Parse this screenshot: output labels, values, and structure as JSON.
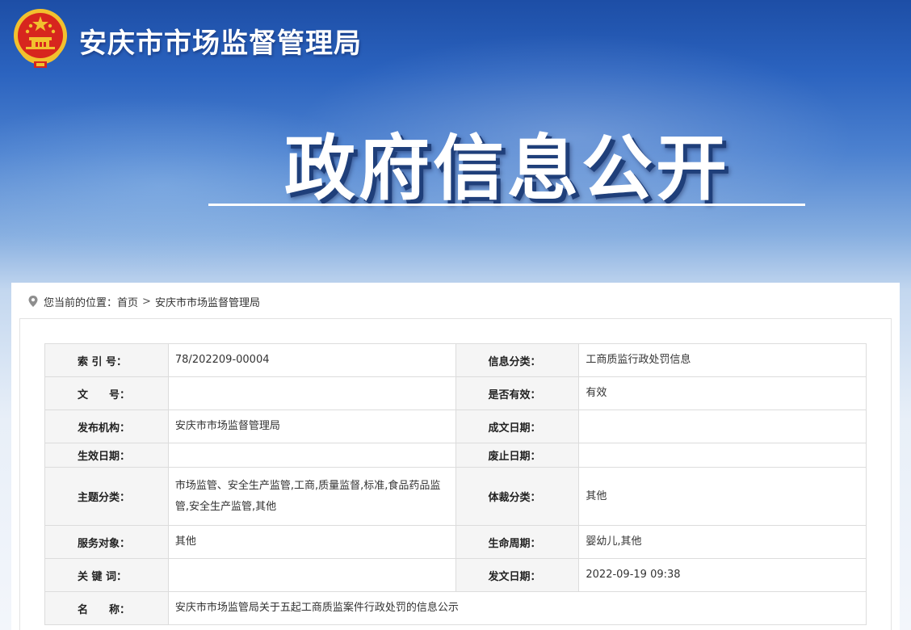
{
  "header": {
    "site_title": "安庆市市场监督管理局",
    "hero_title": "政府信息公开"
  },
  "breadcrumb": {
    "prefix": "您当前的位置：",
    "home": "首页",
    "separator": ">",
    "current": "安庆市市场监督管理局"
  },
  "meta_table": {
    "rows": [
      {
        "k1": "索 引 号：",
        "v1": "78/202209-00004",
        "k2": "信息分类：",
        "v2": "工商质监行政处罚信息"
      },
      {
        "k1": "文　　号：",
        "v1": "",
        "k2": "是否有效：",
        "v2": "有效"
      },
      {
        "k1": "发布机构：",
        "v1": "安庆市市场监督管理局",
        "k2": "成文日期：",
        "v2": ""
      },
      {
        "k1": "生效日期：",
        "v1": "",
        "k2": "废止日期：",
        "v2": ""
      },
      {
        "k1": "主题分类：",
        "v1": "市场监管、安全生产监管,工商,质量监督,标准,食品药品监管,安全生产监管,其他",
        "k2": "体裁分类：",
        "v2": "其他"
      },
      {
        "k1": "服务对象：",
        "v1": "其他",
        "k2": "生命周期：",
        "v2": "婴幼儿,其他"
      },
      {
        "k1": "关 键 词：",
        "v1": "",
        "k2": "发文日期：",
        "v2": "2022-09-19 09:38"
      }
    ],
    "name_row": {
      "k": "名　　称：",
      "v": "安庆市市场监管局关于五起工商质监案件行政处罚的信息公示"
    }
  },
  "colors": {
    "banner_top": "#1d4ea6",
    "emblem_red": "#d7261e",
    "emblem_gold": "#f2c12e"
  },
  "icons": {
    "emblem": "national-emblem-icon",
    "breadcrumb": "location-pin-icon"
  }
}
